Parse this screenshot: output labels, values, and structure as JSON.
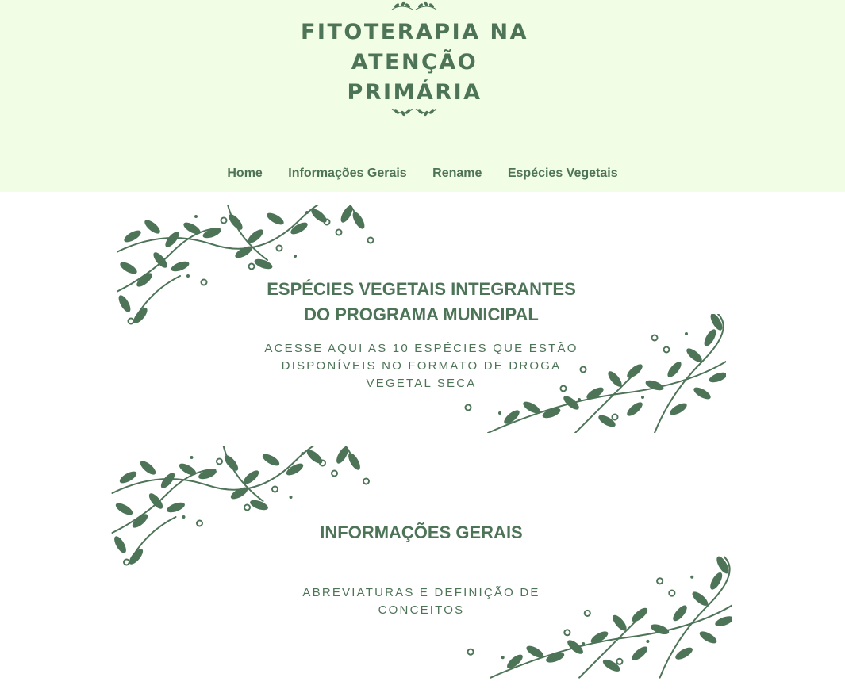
{
  "site": {
    "logo_lines": [
      "FITOTERAPIA NA",
      "ATENÇÃO",
      "PRIMÁRIA"
    ]
  },
  "nav": {
    "items": [
      "Home",
      "Informações Gerais",
      "Rename",
      "Espécies Vegetais"
    ]
  },
  "cards": [
    {
      "title_lines": [
        "ESPÉCIES VEGETAIS INTEGRANTES",
        "DO PROGRAMA MUNICIPAL"
      ],
      "subtitle_lines": [
        "ACESSE AQUI AS 10 ESPÉCIES QUE ESTÃO",
        "DISPONÍVEIS NO FORMATO DE DROGA",
        "VEGETAL SECA"
      ]
    },
    {
      "title_lines": [
        "INFORMAÇÕES GERAIS"
      ],
      "subtitle_lines": [
        "ABREVIATURAS E DEFINIÇÃO DE",
        "CONCEITOS"
      ]
    }
  ],
  "colors": {
    "header_bg": "#f1fde5",
    "accent_green": "#4e7458"
  }
}
